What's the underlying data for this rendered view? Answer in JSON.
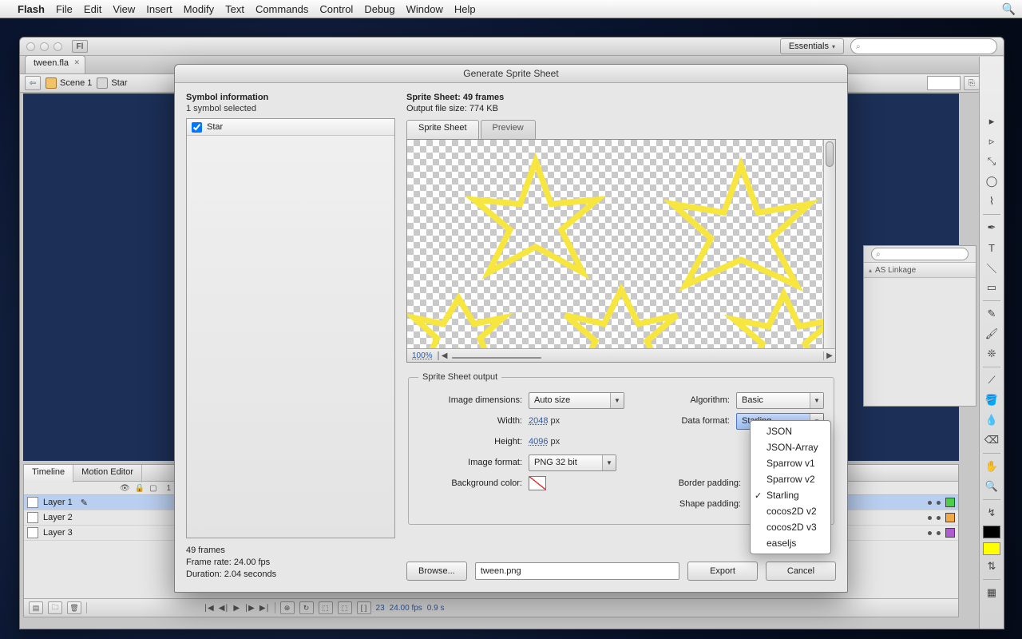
{
  "mac_menubar": {
    "app": "Flash",
    "items": [
      "File",
      "Edit",
      "View",
      "Insert",
      "Modify",
      "Text",
      "Commands",
      "Control",
      "Debug",
      "Window",
      "Help"
    ]
  },
  "flash_window": {
    "workspace_label": "Essentials",
    "doc_tab": "tween.fla",
    "breadcrumb": {
      "scene": "Scene 1",
      "symbol": "Star"
    }
  },
  "library_panel": {
    "col_header": "AS Linkage"
  },
  "timeline": {
    "tabs": [
      "Timeline",
      "Motion Editor"
    ],
    "layers": [
      {
        "name": "Layer 1",
        "color": "green",
        "selected": true
      },
      {
        "name": "Layer 2",
        "color": "orange",
        "selected": false
      },
      {
        "name": "Layer 3",
        "color": "purple",
        "selected": false
      }
    ],
    "status": {
      "frame": "23",
      "fps": "24.00 fps",
      "time": "0.9 s"
    }
  },
  "dialog": {
    "title": "Generate Sprite Sheet",
    "left": {
      "heading": "Symbol information",
      "sub": "1 symbol selected",
      "symbol_name": "Star",
      "info_lines": [
        "49 frames",
        "Frame rate: 24.00 fps",
        "Duration: 2.04 seconds"
      ]
    },
    "right": {
      "head_label": "Sprite Sheet:",
      "head_value": "49 frames",
      "size_label": "Output file size:",
      "size_value": "774 KB",
      "tabs": [
        "Sprite Sheet",
        "Preview"
      ],
      "zoom": "100%"
    },
    "output": {
      "legend": "Sprite Sheet output",
      "image_dimensions_label": "Image dimensions:",
      "image_dimensions_value": "Auto size",
      "width_label": "Width:",
      "width_value": "2048",
      "width_unit": "px",
      "height_label": "Height:",
      "height_value": "4096",
      "height_unit": "px",
      "image_format_label": "Image format:",
      "image_format_value": "PNG 32 bit",
      "bg_label": "Background color:",
      "algorithm_label": "Algorithm:",
      "algorithm_value": "Basic",
      "data_format_label": "Data format:",
      "data_format_value": "Starling",
      "border_padding_label": "Border padding:",
      "shape_padding_label": "Shape padding:"
    },
    "footer": {
      "browse": "Browse...",
      "filename": "tween.png",
      "export": "Export",
      "cancel": "Cancel"
    },
    "data_format_menu": {
      "items": [
        "JSON",
        "JSON-Array",
        "Sparrow v1",
        "Sparrow v2",
        "Starling",
        "cocos2D v2",
        "cocos2D v3",
        "easeljs"
      ],
      "selected": "Starling"
    }
  }
}
